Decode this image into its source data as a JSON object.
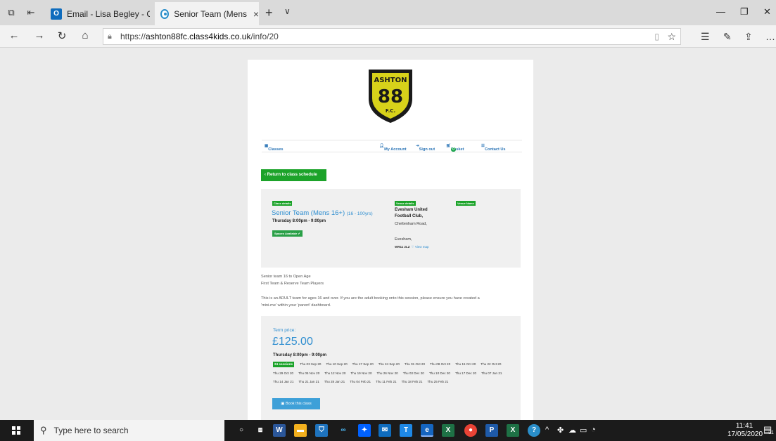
{
  "browser": {
    "tabs": [
      {
        "label": "Email - Lisa Begley - Outloo",
        "icon": "outlook-icon"
      },
      {
        "label": "Senior Team (Mens 16+",
        "icon": "class4kids-icon",
        "close": "×"
      }
    ],
    "new_tab": "+",
    "tab_menu": "∨",
    "url_prefix": "https://",
    "url_domain": "ashton88fc.class4kids.co.uk",
    "url_path": "/info/20"
  },
  "logo": {
    "text_top": "ASHTON",
    "number": "88",
    "text_bottom": "F.C."
  },
  "nav": {
    "classes": "Classes",
    "my_account": "My Account",
    "sign_out": "Sign out",
    "basket": "Basket",
    "basket_count": "0",
    "contact": "Contact Us"
  },
  "return_button": "Return to class schedule",
  "class": {
    "tag_details": "Class details",
    "name": "Senior Team (Mens 16+)",
    "ages": "(16 - 100yrs)",
    "time": "Thursday 8:00pm - 9:00pm",
    "spaces": "Spaces Available"
  },
  "venue": {
    "tag_details": "Venue details",
    "tag_name": "Venue Name",
    "name": "Evesham United Football Club,",
    "road": "Cheltenham Road,",
    "town": "Evesham,",
    "postcode": "WR11 2LZ",
    "map_link": "View map"
  },
  "description": {
    "line1": "Senior team 16 to Open Age",
    "line2": "First Team & Reserve Team Players",
    "line3": "This is an ADULT team for ages 16 and over. If you are the adult booking onto this session, please ensure you have created a",
    "line4": "'mini-me' within your 'parent' dashboard."
  },
  "pricing": {
    "term_label": "Term price:",
    "price": "£125.00",
    "time": "Thursday 8:00pm - 9:00pm",
    "sessions": "24 sessions",
    "dates": [
      "Thu 03 Sep 20",
      "Thu 10 Sep 20",
      "Thu 17 Sep 20",
      "Thu 24 Sep 20",
      "Thu 01 Oct 20",
      "Thu 08 Oct 20",
      "Thu 15 Oct 20",
      "Thu 22 Oct 20",
      "Thu 29 Oct 20",
      "Thu 05 Nov 20",
      "Thu 12 Nov 20",
      "Thu 19 Nov 20",
      "Thu 26 Nov 20",
      "Thu 03 Dec 20",
      "Thu 10 Dec 20",
      "Thu 17 Dec 20",
      "Thu 07 Jan 21",
      "Thu 14 Jan 21",
      "Thu 21 Jan 21",
      "Thu 28 Jan 21",
      "Thu 04 Feb 21",
      "Thu 11 Feb 21",
      "Thu 18 Feb 21",
      "Thu 25 Feb 21"
    ],
    "book_button": "Book this class"
  },
  "taskbar": {
    "search_placeholder": "Type here to search",
    "time": "11:41",
    "date": "17/05/2020",
    "notification_count": "31"
  },
  "colors": {
    "accent_blue": "#2f8ed0",
    "accent_green": "#1ca32a",
    "logo_yellow": "#d8d21a"
  }
}
